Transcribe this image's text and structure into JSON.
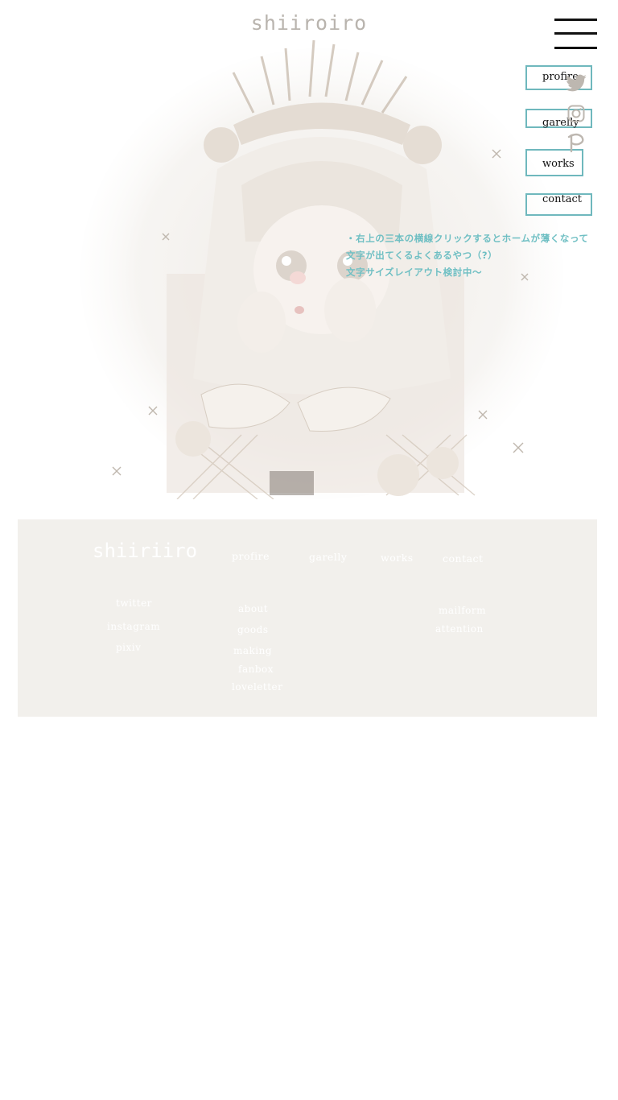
{
  "header": {
    "site_title": "shiiroiro"
  },
  "menu": {
    "items": [
      {
        "label": "profire"
      },
      {
        "label": "garelly"
      },
      {
        "label": "works"
      },
      {
        "label": "contact"
      }
    ]
  },
  "social_icons": [
    "twitter-icon",
    "instagram-icon",
    "pixiv-icon"
  ],
  "notes": {
    "lines": [
      "・右上の三本の横線クリックするとホームが薄くなって",
      "文字が出てくるよくあるやつ（?）",
      "文字サイズレイアウト検討中～"
    ]
  },
  "footer": {
    "brand": "shiiriiro",
    "columns": {
      "profire": "profire",
      "garelly": "garelly",
      "works": "works",
      "contact": "contact"
    },
    "social_links": [
      "twitter",
      "instagram",
      "pixiv"
    ],
    "profire_links": [
      "about",
      "goods",
      "making",
      "fanbox",
      "loveletter"
    ],
    "contact_links": [
      "mailform",
      "attention"
    ]
  },
  "colors": {
    "accent": "#6fb8bd",
    "note_text": "#6fbfc3",
    "title_gray": "#b9b4ae",
    "footer_bg": "#f2f0ec"
  }
}
